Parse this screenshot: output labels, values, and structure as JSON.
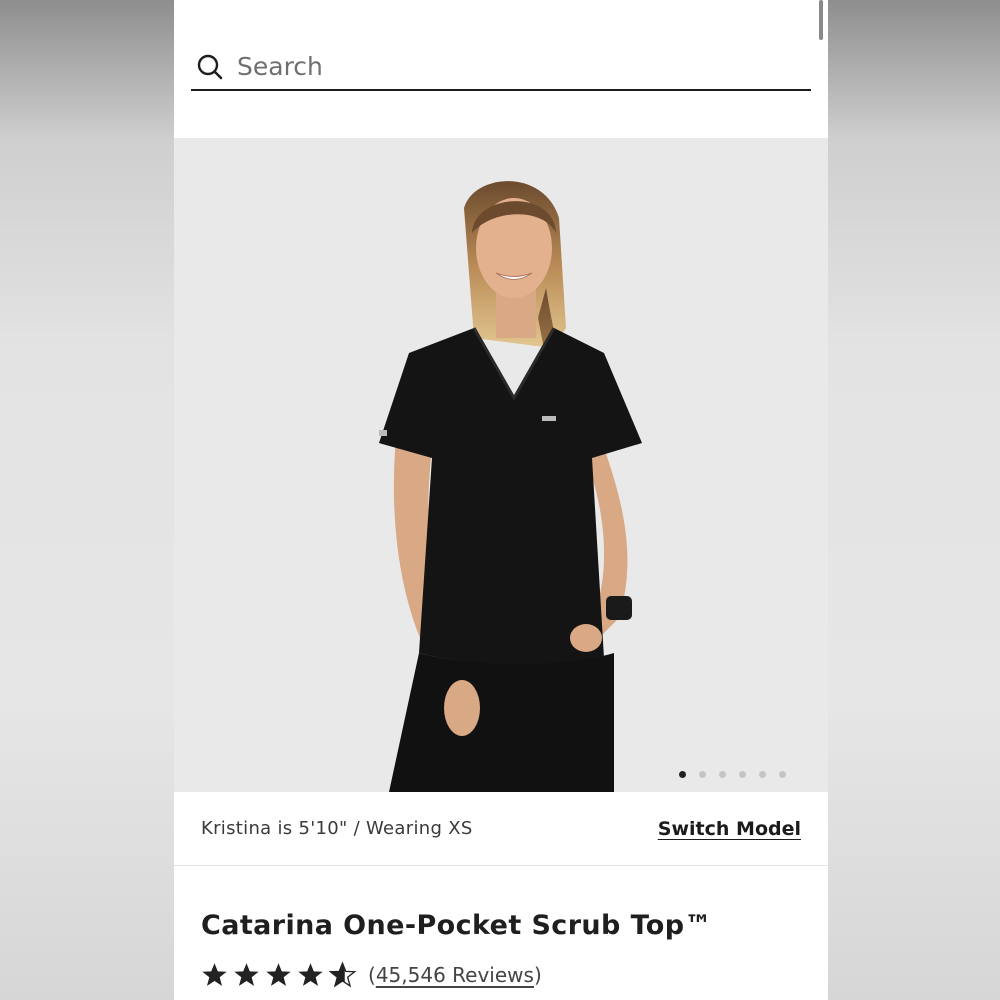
{
  "search": {
    "placeholder": "Search"
  },
  "hero": {
    "carousel_dots": 6,
    "active_dot": 0
  },
  "model": {
    "info": "Kristina is 5'10\" / Wearing XS",
    "switch_label": "Switch Model"
  },
  "product": {
    "title": "Catarina One-Pocket Scrub Top™",
    "rating": 4.5,
    "rating_max": 5,
    "reviews_open": "(",
    "reviews_link": "45,546 Reviews",
    "reviews_close": ")"
  },
  "colors": {
    "accent": "#1b1b1b",
    "background": "#ffffff",
    "hero_bg": "#e9e9e9"
  },
  "icons": {
    "search": "search-icon",
    "star": "star-icon"
  }
}
